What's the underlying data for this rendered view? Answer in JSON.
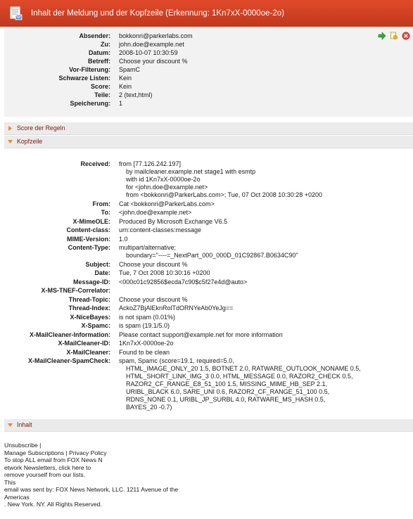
{
  "title_bar": {
    "title": "Inhalt der Meldung und der Kopfzeile (Erkennung: 1Kn7xX-0000oe-2o)"
  },
  "summary": {
    "rows": [
      {
        "key": "Absender:",
        "value": "bokkonri@parkerlabs.com"
      },
      {
        "key": "Zu:",
        "value": "john.doe@example.net"
      },
      {
        "key": "Datum:",
        "value": "2008-10-07 10:30:59"
      },
      {
        "key": "Betreff:",
        "value": "Choose your discount %"
      },
      {
        "key": "Vor-Filterung:",
        "value": "SpamC"
      },
      {
        "key": "Schwarze Listen:",
        "value": "Kein"
      },
      {
        "key": "Score:",
        "value": "Kein"
      },
      {
        "key": "Teile:",
        "value": "2 (text,html)"
      },
      {
        "key": "Speicherung:",
        "value": "1"
      }
    ],
    "actions": [
      "forward-icon",
      "release-icon",
      "delete-icon"
    ]
  },
  "sections": {
    "score": "Score der Regeln",
    "headers": "Kopfzeile",
    "content": "Inhalt"
  },
  "headers": [
    {
      "key": "Received:",
      "value": "from [77.126.242.197]\n    by mailcleaner.example.net stage1 with esmtp\n    with id 1Kn7xX-0000oe-2o\n    for <john.doe@example.net>\n    from <bokkonri@ParkerLabs.com>; Tue, 07 Oct 2008 10:30:28 +0200"
    },
    {
      "key": "From:",
      "value": "Cat <bokkonri@ParkerLabs.com>"
    },
    {
      "key": "To:",
      "value": "<john.doe@example.net>"
    },
    {
      "key": "X-MimeOLE:",
      "value": "Produced By Microsoft Exchange V6.5"
    },
    {
      "key": "Content-class:",
      "value": "urn:content-classes:message"
    },
    {
      "key": "MIME-Version:",
      "value": "1.0"
    },
    {
      "key": "Content-Type:",
      "value": "multipart/alternative;\n    boundary=\"----=_NextPart_000_000D_01C92867.B0634C90\""
    },
    {
      "key": "Subject:",
      "value": "Choose your discount %"
    },
    {
      "key": "Date:",
      "value": "Tue, 7 Oct 2008 10:30:16 +0200"
    },
    {
      "key": "Message-ID:",
      "value": "<000c01c92856$ecda7c90$c5f27e4d@auto>"
    },
    {
      "key": "X-MS-TNEF-Correlator:",
      "value": ""
    },
    {
      "key": "Thread-Topic:",
      "value": "Choose your discount %"
    },
    {
      "key": "Thread-Index:",
      "value": "AckoZ7BjAlEknRolTdORNYeAb0YeJg=="
    },
    {
      "key": "X-NiceBayes:",
      "value": "is not spam (0.01%)"
    },
    {
      "key": "X-Spamc:",
      "value": "is spam (19.1/5.0)"
    },
    {
      "key": "X-MailCleaner-Information:",
      "value": "Please contact support@example.net for more information"
    },
    {
      "key": "X-MailCleaner-ID:",
      "value": "1Kn7xX-0000oe-2o"
    },
    {
      "key": "X-MailCleaner:",
      "value": "Found to be clean"
    },
    {
      "key": "X-MailCleaner-SpamCheck:",
      "value": "spam, Spamc (score=19.1, required=5.0,\n    HTML_IMAGE_ONLY_20 1.5, BOTNET 2.0, RATWARE_OUTLOOK_NONAME 0.5,\n    HTML_SHORT_LINK_IMG_3 0.0, HTML_MESSAGE 0.0, RAZOR2_CHECK 0.5,\n    RAZOR2_CF_RANGE_E8_51_100 1.5, MISSING_MIME_HB_SEP 2.1,\n    URIBL_BLACK 6.0, SARE_UNI 0.6, RAZOR2_CF_RANGE_51_100 0.5,\n    RDNS_NONE 0.1, URIBL_JP_SURBL 4.0, RATWARE_MS_HASH 0.5,\n    BAYES_20 -0.7)"
    }
  ],
  "body_lines": [
    "Unsubscribe |",
    "Manage Subscriptions | Privacy Policy",
    "To stop ALL email from FOX News N",
    "etwork Newsletters, click here to",
    "remove yourself from our lists.",
    "This",
    "email was sent by: FOX News Network, LLC. 1211 Avenue of the",
    "Americas",
    ". New York. NY. All Rights Reserved."
  ],
  "colors": {
    "title_bar": "#d2401f",
    "section_label": "#7a1a10",
    "triangle": "#e8892b"
  }
}
